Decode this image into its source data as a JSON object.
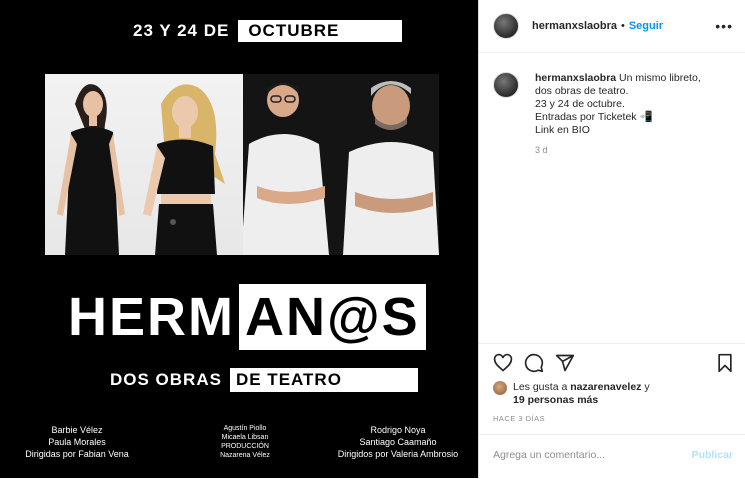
{
  "post_image": {
    "date_left": "23 Y 24 DE",
    "date_box": "OCTUBRE",
    "logo_left": "HERM",
    "logo_right": "AN@S",
    "subtitle_left": "DOS OBRAS",
    "subtitle_box": "DE TEATRO",
    "credits_left": [
      "Barbie Vélez",
      "Paula Morales",
      "Dirigidas por Fabian Vena"
    ],
    "credits_center": [
      "Agustín Piollo",
      "Micaela Libsan",
      "PRODUCCIÓN",
      "Nazarena Vélez"
    ],
    "credits_right": [
      "Rodrigo Noya",
      "Santiago Caamaño",
      "Dirigidos por Valeria Ambrosio"
    ]
  },
  "header": {
    "username": "hermanxslaobra",
    "separator": "•",
    "follow": "Seguir",
    "more": "•••"
  },
  "caption": {
    "username": "hermanxslaobra",
    "lines": [
      "Un mismo libreto,",
      "dos obras de teatro.",
      "23 y 24 de octubre.",
      "Entradas por Ticketek 📲",
      "Link en BIO"
    ],
    "time": "3 d"
  },
  "actions": {
    "icons": [
      "heart-icon",
      "comment-icon",
      "share-icon",
      "bookmark-icon"
    ]
  },
  "likes": {
    "prefix": "Les gusta a",
    "user": "nazarenavelez",
    "connector": "y",
    "others": "19 personas más"
  },
  "posted_ago": "HACE 3 DÍAS",
  "comment": {
    "placeholder": "Agrega un comentario...",
    "publish": "Publicar"
  },
  "colors": {
    "accent": "#0095f6",
    "publish_disabled": "#b2dffc",
    "text": "#262626",
    "muted": "#8e8e8e",
    "image_bg": "#000000"
  }
}
